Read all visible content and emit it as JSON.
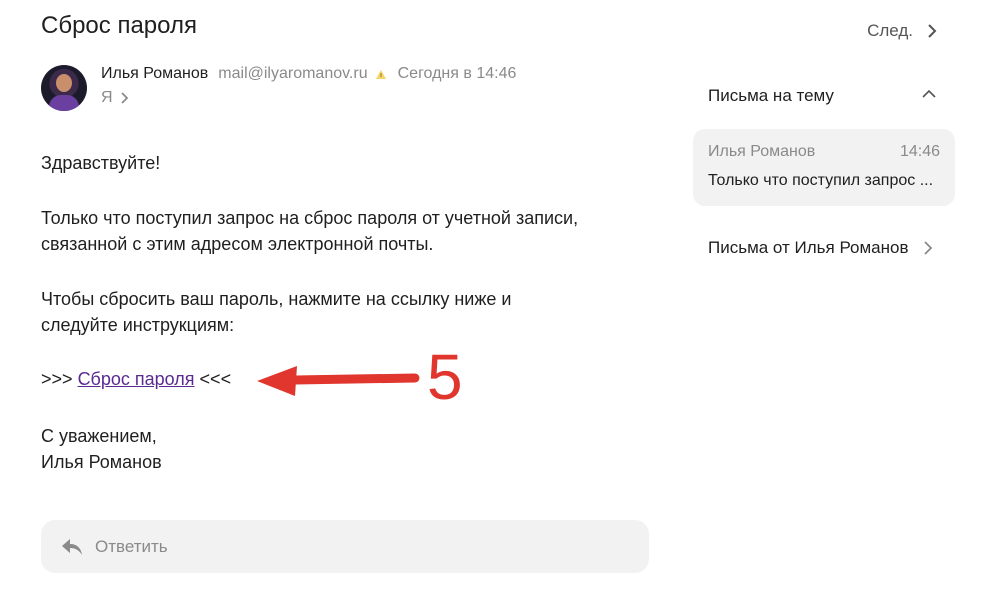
{
  "message": {
    "subject": "Сброс пароля",
    "sender_name": "Илья Романов",
    "sender_email": "mail@ilyaromanov.ru",
    "time": "Сегодня в 14:46",
    "to": "Я",
    "greeting": "Здравствуйте!",
    "paragraph1_line1": "Только что поступил запрос на сброс пароля от учетной записи,",
    "paragraph1_line2": "связанной с этим адресом электронной почты.",
    "paragraph2_line1": "Чтобы сбросить ваш пароль, нажмите на ссылку ниже и",
    "paragraph2_line2": "следуйте инструкциям:",
    "link_prefix": ">>>",
    "link_text": "Сброс пароля",
    "link_suffix": "<<<",
    "sign_line1": "С уважением,",
    "sign_line2": "Илья Романов"
  },
  "annotation": {
    "number": "5",
    "color": "#e0362d"
  },
  "reply": {
    "label": "Ответить"
  },
  "nav": {
    "next_label": "След."
  },
  "thread": {
    "title": "Письма на тему",
    "items": [
      {
        "name": "Илья Романов",
        "time": "14:46",
        "snippet": "Только что поступил запрос ..."
      }
    ],
    "from_sender_label": "Письма от Илья Романов"
  },
  "colors": {
    "link": "#5a2a92",
    "muted": "#8a8a8a",
    "card_bg": "#f2f2f2"
  },
  "icons": [
    "avatar",
    "flag-icon",
    "chevron-right-icon",
    "chevron-up-icon",
    "reply-arrow-icon",
    "red-arrow-icon"
  ]
}
